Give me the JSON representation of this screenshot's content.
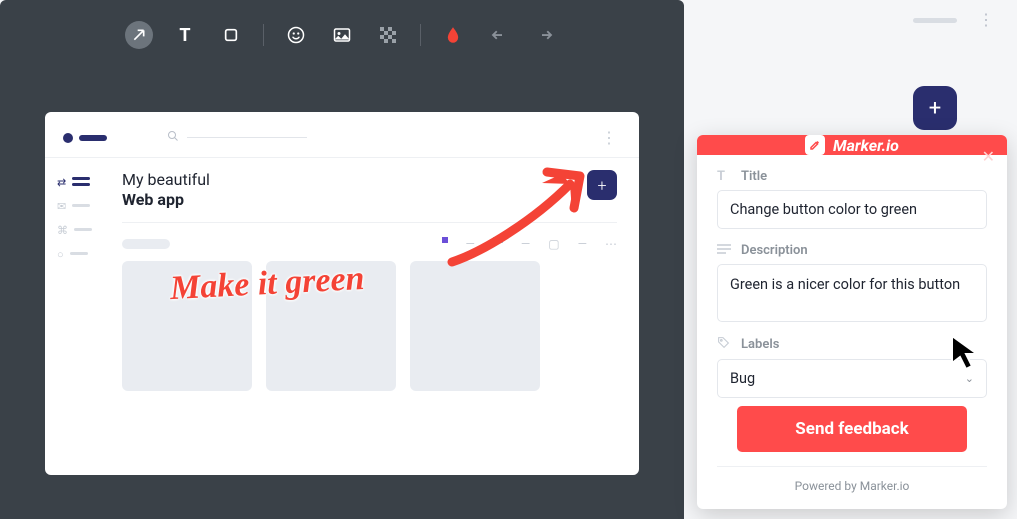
{
  "toolbar": {
    "tools": [
      {
        "name": "arrow-tool-icon",
        "active": true
      },
      {
        "name": "text-tool-icon"
      },
      {
        "name": "rect-tool-icon"
      },
      {
        "name": "emoji-tool-icon"
      },
      {
        "name": "image-tool-icon"
      },
      {
        "name": "blur-tool-icon"
      },
      {
        "name": "color-tool-icon",
        "color": "#f44336"
      },
      {
        "name": "undo-icon"
      },
      {
        "name": "redo-icon"
      }
    ]
  },
  "app": {
    "title_line1": "My beautiful",
    "title_line2": "Web app",
    "plus_label": "+"
  },
  "annotation": {
    "text": "Make it green"
  },
  "floating": {
    "plus_label": "+"
  },
  "panel": {
    "brand": "Marker.io",
    "title_label": "Title",
    "title_value": "Change button color to green",
    "desc_label": "Description",
    "desc_value": "Green is a nicer color for this button",
    "labels_label": "Labels",
    "labels_value": "Bug",
    "submit": "Send feedback",
    "footer": "Powered by Marker.io"
  }
}
